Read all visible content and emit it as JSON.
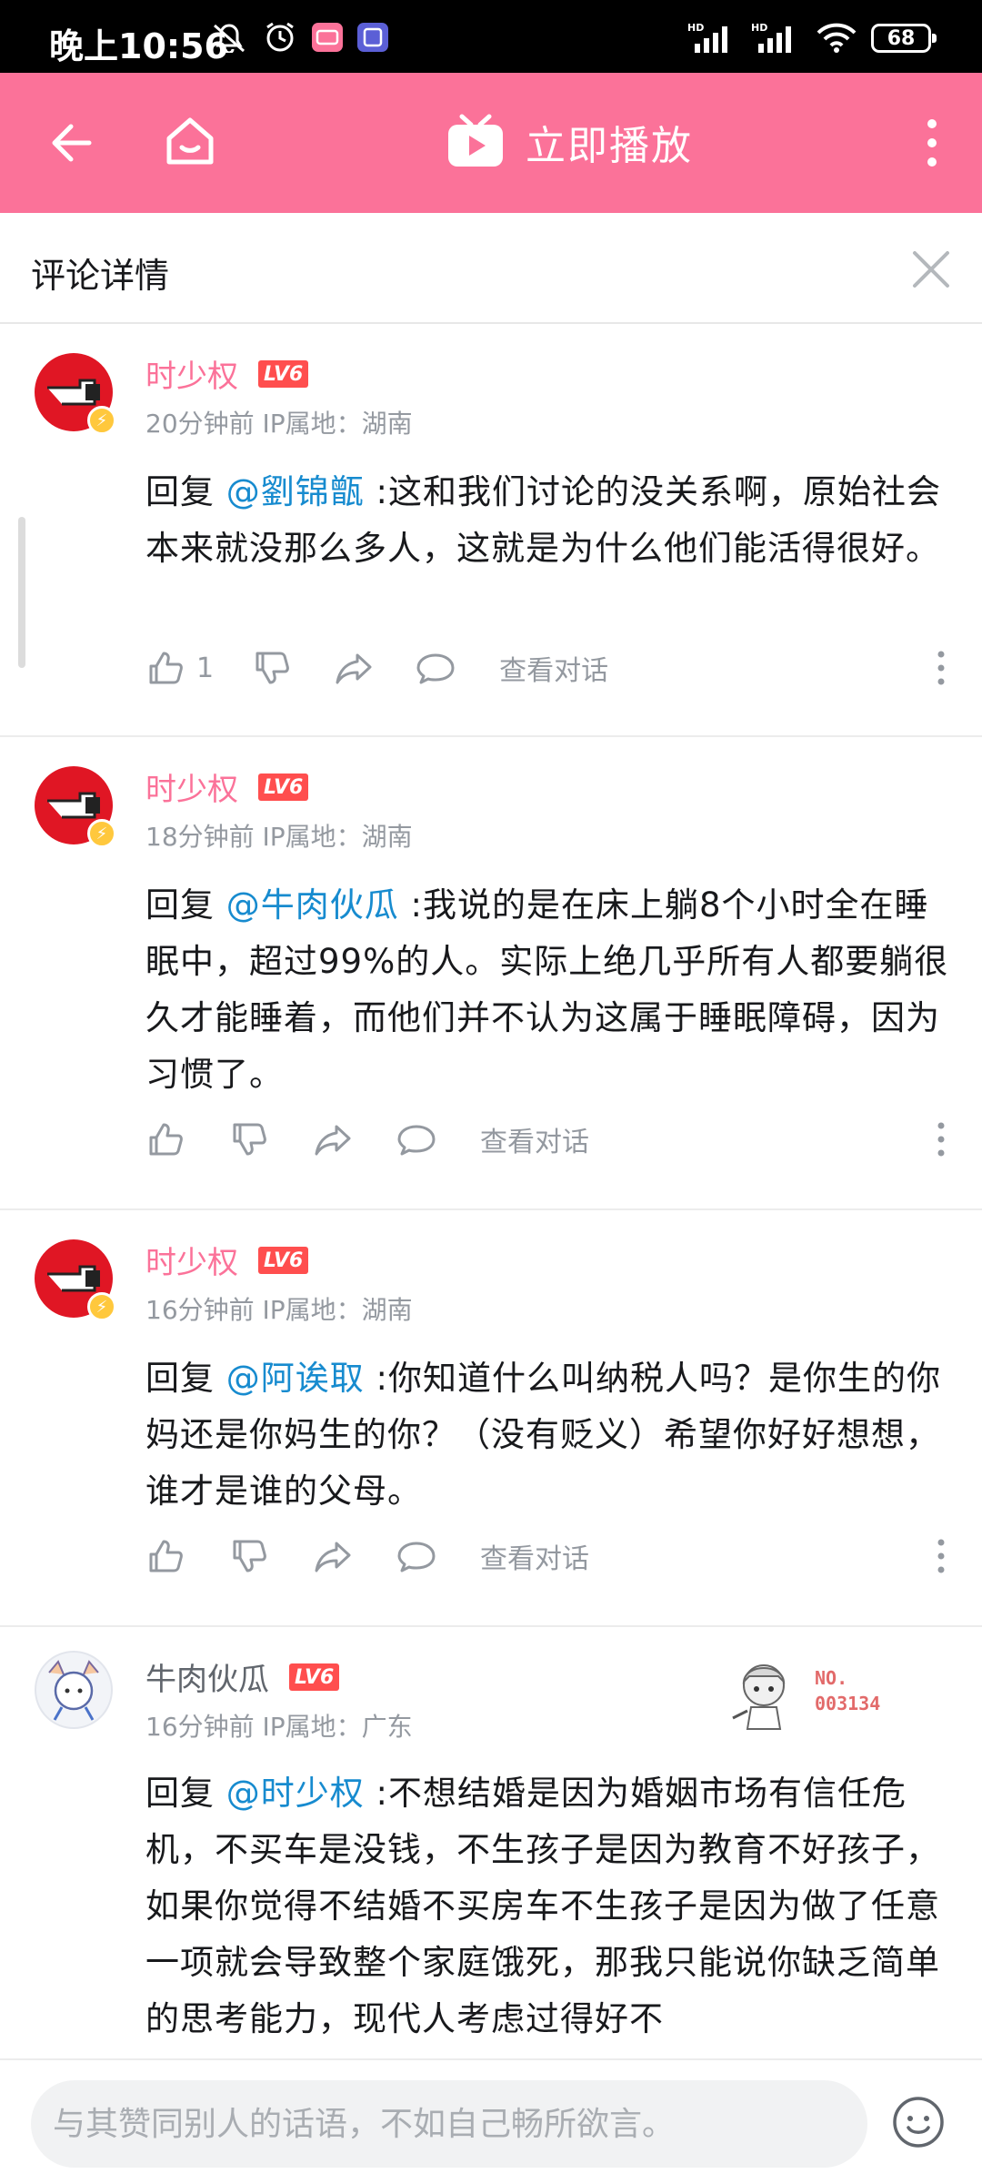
{
  "status_bar": {
    "time": "晚上10:56",
    "battery": "68",
    "hd1": "HD",
    "hd2": "HD"
  },
  "top_bar": {
    "play_label": "立即播放",
    "accent_color": "#fb7299"
  },
  "section": {
    "title": "评论详情"
  },
  "comments": [
    {
      "user": "时少权",
      "level": "LV6",
      "meta": "20分钟前  IP属地：湖南",
      "reply_prefix": "回复 ",
      "mention": "@劉锦甑",
      "text": " :这和我们讨论的没关系啊，原始社会本来就没那么多人，这就是为什么他们能活得很好。",
      "like_count": "1",
      "view_dialog": "查看对话"
    },
    {
      "user": "时少权",
      "level": "LV6",
      "meta": "18分钟前  IP属地：湖南",
      "reply_prefix": "回复 ",
      "mention": "@牛肉伙瓜",
      "text": " :我说的是在床上躺8个小时全在睡眠中，超过99%的人。实际上绝几乎所有人都要躺很久才能睡着，而他们并不认为这属于睡眠障碍，因为习惯了。",
      "view_dialog": "查看对话"
    },
    {
      "user": "时少权",
      "level": "LV6",
      "meta": "16分钟前  IP属地：湖南",
      "reply_prefix": "回复 ",
      "mention": "@阿诶取",
      "text": " :你知道什么叫纳税人吗？是你生的你妈还是你妈生的你？（没有贬义）希望你好好想想，谁才是谁的父母。",
      "view_dialog": "查看对话"
    },
    {
      "user": "牛肉伙瓜",
      "level": "LV6",
      "meta": "16分钟前  IP属地：广东",
      "reply_prefix": "回复 ",
      "mention": "@时少权",
      "text": " :不想结婚是因为婚姻市场有信任危机，不买车是没钱，不生孩子是因为教育不好孩子，如果你觉得不结婚不买房车不生孩子是因为做了任意一项就会导致整个家庭饿死，那我只能说你缺乏简单的思考能力，现代人考虑过得好不",
      "medal_no_1": "NO.",
      "medal_no_2": "003134"
    }
  ],
  "input": {
    "placeholder": "与其赞同别人的话语，不如自己畅所欲言。"
  }
}
